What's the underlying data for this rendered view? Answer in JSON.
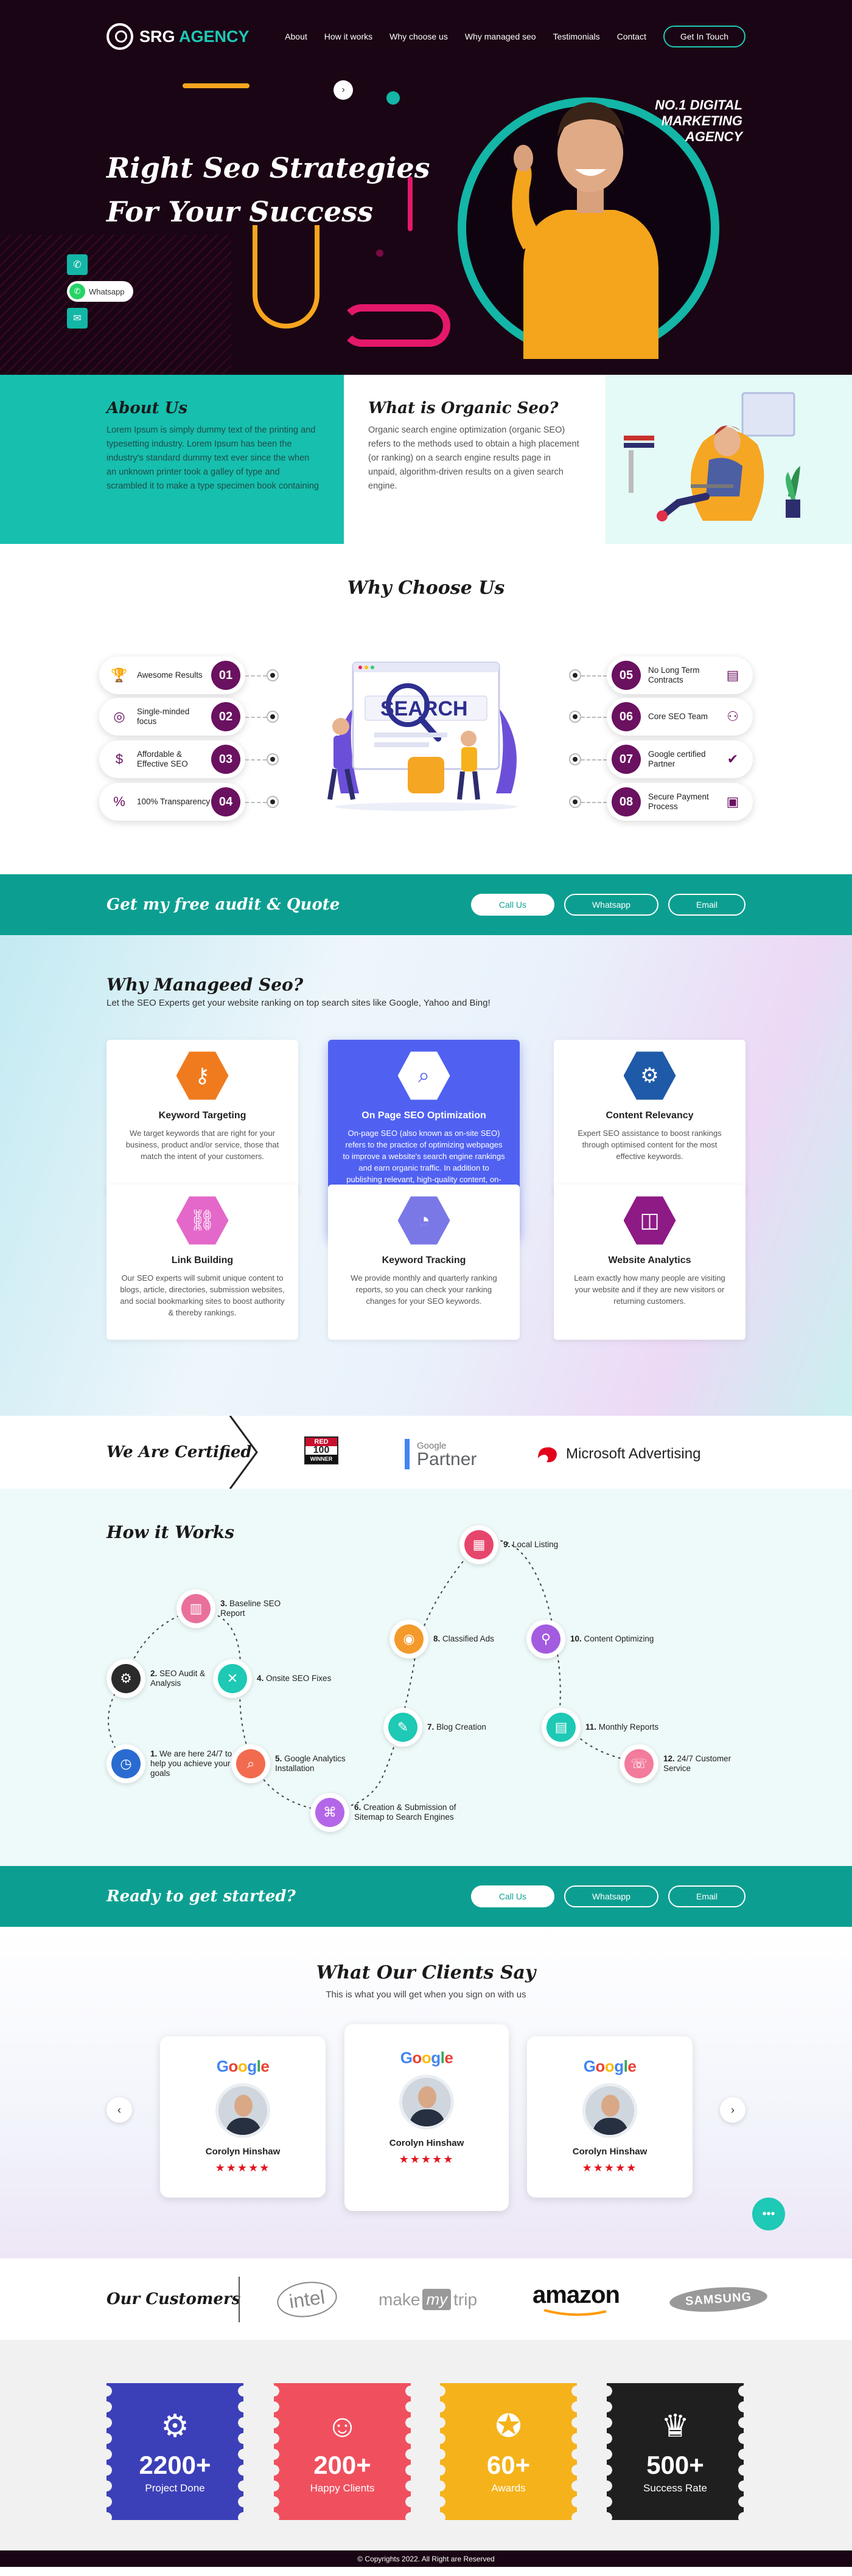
{
  "nav": {
    "logo_main": "SRG",
    "logo_accent": "AGENCY",
    "items": [
      "About",
      "How it works",
      "Why choose us",
      "Why managed seo",
      "Testimonials",
      "Contact"
    ],
    "cta": "Get In Touch"
  },
  "hero": {
    "title_line1": "Right Seo Strategies",
    "title_line2": "For Your Success",
    "badge_line1": "NO.1 DIGITAL",
    "badge_line2": "MARKETING",
    "badge_line3": "AGENCY",
    "whatsapp_label": "Whatsapp"
  },
  "about": {
    "title": "About Us",
    "text": "Lorem Ipsum is simply dummy text of the printing and typesetting industry. Lorem Ipsum has been the industry's standard dummy text ever since the when an unknown printer took a galley of type and scrambled it to make a type specimen book containing",
    "organic_title": "What is Organic Seo?",
    "organic_text": "Organic search engine optimization (organic SEO) refers to the methods used to obtain a high placement (or ranking) on a search engine results page in unpaid, algorithm-driven results on a given search engine."
  },
  "why": {
    "title": "Why Choose Us",
    "illustration_text": "SEARCH",
    "left": [
      {
        "label": "Awesome Results",
        "num": "01",
        "icon": "award-icon"
      },
      {
        "label": "Single-minded focus",
        "num": "02",
        "icon": "target-icon"
      },
      {
        "label": "Affordable & Effective SEO",
        "num": "03",
        "icon": "dollar-icon"
      },
      {
        "label": "100% Transparency",
        "num": "04",
        "icon": "percent-icon"
      }
    ],
    "right": [
      {
        "label": "No Long Term Contracts",
        "num": "05",
        "icon": "contract-icon"
      },
      {
        "label": "Core SEO Team",
        "num": "06",
        "icon": "team-icon"
      },
      {
        "label": "Google certified Partner",
        "num": "07",
        "icon": "certificate-icon"
      },
      {
        "label": "Secure Payment Process",
        "num": "08",
        "icon": "wallet-icon"
      }
    ]
  },
  "cta1": {
    "title": "Get my free audit & Quote",
    "call": "Call Us",
    "whatsapp": "Whatsapp",
    "email": "Email"
  },
  "managed": {
    "title": "Why Manageed Seo?",
    "subtitle": "Let the SEO Experts get your website ranking on top search sites like Google, Yahoo and Bing!",
    "cards": [
      {
        "title": "Keyword Targeting",
        "text": "We target keywords that are right for your business, product and/or service, those that match the intent of your customers.",
        "color": "#f07b1e",
        "icon": "keyword-icon"
      },
      {
        "title": "On Page SEO Optimization",
        "text": "On-page SEO (also known as on-site SEO) refers to the practice of optimizing webpages to improve a website's search engine rankings and earn organic traffic. In addition to publishing relevant, high-quality content, on-page SEO includes optimizing your headlines, HTML tags (title, meta, and header), and images.",
        "color": "#5061f2",
        "icon": "seo-icon"
      },
      {
        "title": "Content Relevancy",
        "text": "Expert SEO assistance to boost rankings through optimised content for the most effective keywords.",
        "color": "#1f5aa8",
        "icon": "content-icon"
      },
      {
        "title": "Link Building",
        "text": "Our SEO experts will submit unique content to blogs, article, directories, submission websites, and social bookmarking sites to boost authority & thereby rankings.",
        "color": "#e468c9",
        "icon": "link-icon"
      },
      {
        "title": "Keyword Tracking",
        "text": "We provide monthly and quarterly ranking reports, so you can check your ranking changes for your SEO keywords.",
        "color": "#7a78e6",
        "icon": "tracking-icon"
      },
      {
        "title": "Website Analytics",
        "text": "Learn exactly how many people are visiting your website and if they are new visitors or returning customers.",
        "color": "#8e1a86",
        "icon": "analytics-icon"
      }
    ]
  },
  "certified": {
    "title": "We Are Certified",
    "redhot_top": "RED",
    "redhot_mid": "100",
    "redhot_bottom": "WINNER",
    "google_text": "Google",
    "partner_text": "Partner",
    "microsoft_text": "Microsoft Advertising"
  },
  "how": {
    "title": "How it Works",
    "steps": [
      {
        "num": "1.",
        "label": "We are here 24/7 to help you achieve your goals",
        "color": "#2a6bd1",
        "icon": "clock-icon"
      },
      {
        "num": "2.",
        "label": "SEO Audit & Analysis",
        "color": "#2b2b2b",
        "icon": "audit-icon"
      },
      {
        "num": "3.",
        "label": "Baseline SEO Report",
        "color": "#e9709b",
        "icon": "report-icon"
      },
      {
        "num": "4.",
        "label": "Onsite SEO Fixes",
        "color": "#1ec9b5",
        "icon": "tools-icon"
      },
      {
        "num": "5.",
        "label": "Google Analytics Installation",
        "color": "#f26b4f",
        "icon": "analytics-search-icon"
      },
      {
        "num": "6.",
        "label": "Creation & Submission of Sitemap to Search Engines",
        "color": "#b466e8",
        "icon": "sitemap-icon"
      },
      {
        "num": "7.",
        "label": "Blog Creation",
        "color": "#1ec9b5",
        "icon": "blog-icon"
      },
      {
        "num": "8.",
        "label": "Classified Ads",
        "color": "#f39a2b",
        "icon": "ads-icon"
      },
      {
        "num": "9.",
        "label": "Local Listing",
        "color": "#e7466c",
        "icon": "listing-icon"
      },
      {
        "num": "10.",
        "label": "Content Optimizing",
        "color": "#a35be0",
        "icon": "content-optimize-icon"
      },
      {
        "num": "11.",
        "label": "Monthly Reports",
        "color": "#1ec9b5",
        "icon": "monthly-report-icon"
      },
      {
        "num": "12.",
        "label": "24/7 Customer Service",
        "color": "#f37b9b",
        "icon": "support-icon"
      }
    ]
  },
  "cta2": {
    "title": "Ready to get started?",
    "call": "Call Us",
    "whatsapp": "Whatsapp",
    "email": "Email"
  },
  "clients": {
    "title": "What Our Clients Say",
    "subtitle": "This is what you will get when you sign on with us",
    "testimonials": [
      {
        "brand": "Google",
        "name": "Corolyn Hinshaw",
        "stars": "★★★★★"
      },
      {
        "brand": "Google",
        "name": "Corolyn Hinshaw",
        "stars": "★★★★★"
      },
      {
        "brand": "Google",
        "name": "Corolyn Hinshaw",
        "stars": "★★★★★"
      }
    ]
  },
  "customers": {
    "title": "Our Customers",
    "logos": [
      "intel",
      "make",
      "my",
      "trip",
      "amazon",
      "SAMSUNG"
    ]
  },
  "stats": [
    {
      "value": "2200+",
      "label": "Project Done",
      "color": "#3c40b8",
      "icon": "project-icon"
    },
    {
      "value": "200+",
      "label": "Happy Clients",
      "color": "#f0505e",
      "icon": "smile-icon"
    },
    {
      "value": "60+",
      "label": "Awards",
      "color": "#f5b21b",
      "icon": "award-icon"
    },
    {
      "value": "500+",
      "label": "Success Rate",
      "color": "#1f1f1f",
      "icon": "success-icon"
    }
  ],
  "footer": {
    "text": "© Copyrights 2022. All Right are Reserved"
  }
}
